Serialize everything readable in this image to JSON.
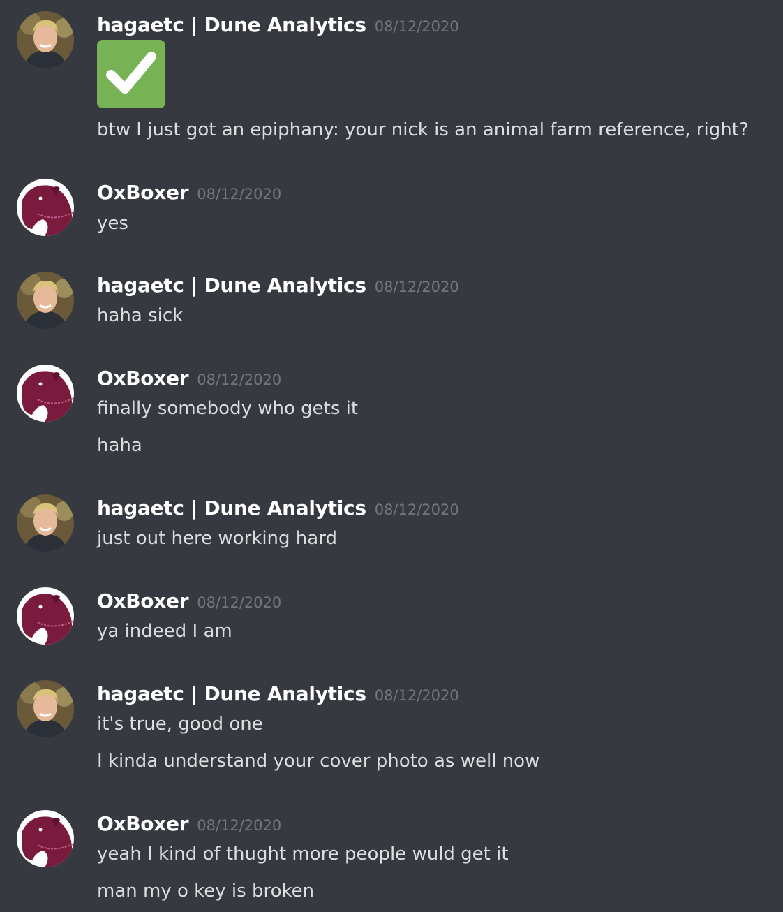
{
  "messages": [
    {
      "author": "hagaetc | Dune Analytics",
      "timestamp": "08/12/2020",
      "avatar": "person-avatar",
      "emoji": "white-heavy-check-mark",
      "lines": [
        "btw I just got an epiphany: your nick is an animal farm reference, right?"
      ]
    },
    {
      "author": "OxBoxer",
      "timestamp": "08/12/2020",
      "avatar": "horse-avatar",
      "lines": [
        "yes"
      ]
    },
    {
      "author": "hagaetc | Dune Analytics",
      "timestamp": "08/12/2020",
      "avatar": "person-avatar",
      "lines": [
        "haha sick"
      ]
    },
    {
      "author": "OxBoxer",
      "timestamp": "08/12/2020",
      "avatar": "horse-avatar",
      "lines": [
        "finally somebody who gets it",
        "haha"
      ]
    },
    {
      "author": "hagaetc | Dune Analytics",
      "timestamp": "08/12/2020",
      "avatar": "person-avatar",
      "lines": [
        "just out here working hard"
      ]
    },
    {
      "author": "OxBoxer",
      "timestamp": "08/12/2020",
      "avatar": "horse-avatar",
      "lines": [
        "ya indeed I am"
      ]
    },
    {
      "author": "hagaetc | Dune Analytics",
      "timestamp": "08/12/2020",
      "avatar": "person-avatar",
      "lines": [
        "it's true, good one",
        "I kinda understand your cover photo as well now"
      ]
    },
    {
      "author": "OxBoxer",
      "timestamp": "08/12/2020",
      "avatar": "horse-avatar",
      "lines": [
        "yeah I kind of thught more people wuld get it",
        "man my o key is broken"
      ]
    }
  ],
  "colors": {
    "background": "#36393f",
    "username": "#ffffff",
    "timestamp": "#72767d",
    "message_text": "#dcddde",
    "emoji_green": "#77b255",
    "horse_maroon": "#7a1a3c"
  }
}
